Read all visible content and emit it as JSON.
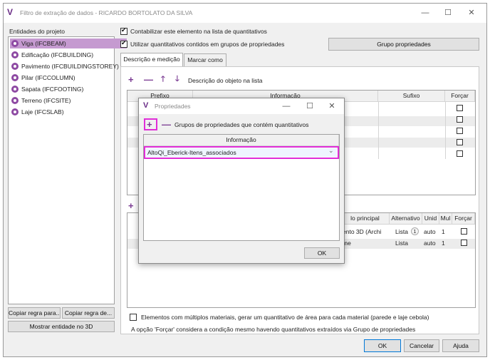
{
  "window": {
    "logo": "V",
    "title": "Filtro de extração de dados - RICARDO BORTOLATO DA SILVA",
    "minimize_icon": "—",
    "maximize_icon": "☐",
    "close_icon": "✕"
  },
  "entities": {
    "label": "Entidades do projeto",
    "items": [
      {
        "label": "Viga (IFCBEAM)",
        "selected": true
      },
      {
        "label": "Edificação (IFCBUILDING)"
      },
      {
        "label": "Pavimento (IFCBUILDINGSTOREY)"
      },
      {
        "label": "Pilar (IFCCOLUMN)"
      },
      {
        "label": "Sapata (IFCFOOTING)"
      },
      {
        "label": "Terreno (IFCSITE)"
      },
      {
        "label": "Laje (IFCSLAB)"
      }
    ],
    "copy_rule_for": "Copiar regra para...",
    "copy_rule_from": "Copiar regra de...",
    "show_3d": "Mostrar entidade no 3D"
  },
  "options": {
    "accumulate": "Contabilizar este elemento na lista de quantitativos",
    "use_property_groups": "Utilizar quantitativos contidos em grupos de propriedades",
    "group_properties_button": "Grupo propriedades"
  },
  "tabs": {
    "description": "Descrição e medição",
    "mark_as": "Marcar como"
  },
  "description_toolbar": {
    "add": "+",
    "remove": "—",
    "up": "🡑",
    "down": "🡓",
    "label": "Descrição do objeto na lista"
  },
  "description_grid": {
    "headers": [
      "Prefixo",
      "Informação",
      "Sufixo",
      "Forçar"
    ]
  },
  "measurement_toolbar": {
    "add": "+"
  },
  "measurement_grid": {
    "headers": [
      "lo principal",
      "Alternativo",
      "Unid",
      "Mul",
      "Forçar"
    ],
    "rows": [
      {
        "principal": "ento 3D (Archi",
        "alt": "Lista",
        "alt_badge": "1",
        "unit": "auto",
        "mul": "1"
      },
      {
        "principal": "me",
        "alt": "Lista",
        "alt_badge": "",
        "unit": "auto",
        "mul": "1"
      }
    ]
  },
  "bottom": {
    "multi_material": "Elementos com múltiplos materiais, gerar um quantitativo de área para cada material (parede e laje cebola)",
    "force_note": "A opção 'Forçar' considera a condição mesmo havendo quantitativos extraídos via Grupo de propriedades"
  },
  "footer": {
    "ok": "OK",
    "cancel": "Cancelar",
    "help": "Ajuda"
  },
  "dialog": {
    "logo": "V",
    "title": "Propriedades",
    "minimize_icon": "—",
    "maximize_icon": "☐",
    "close_icon": "✕",
    "add": "+",
    "remove": "—",
    "label": "Grupos de propriedades que contém quantitativos",
    "column_header": "Informação",
    "selected_value": "AltoQi_Eberick-Itens_associados",
    "dropdown_icon": "⌄",
    "ok": "OK"
  },
  "colors": {
    "accent": "#7a3a92",
    "selection": "#c59ad0",
    "highlight": "#e02ed8"
  }
}
